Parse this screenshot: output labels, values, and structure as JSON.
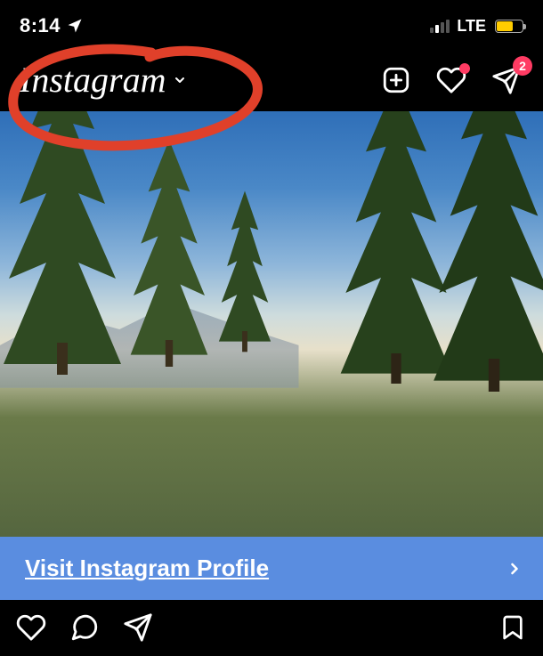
{
  "statusbar": {
    "time": "8:14",
    "network": "LTE"
  },
  "header": {
    "logo_text": "Instagram",
    "dm_badge": "2"
  },
  "banner": {
    "text": "Visit Instagram Profile"
  }
}
